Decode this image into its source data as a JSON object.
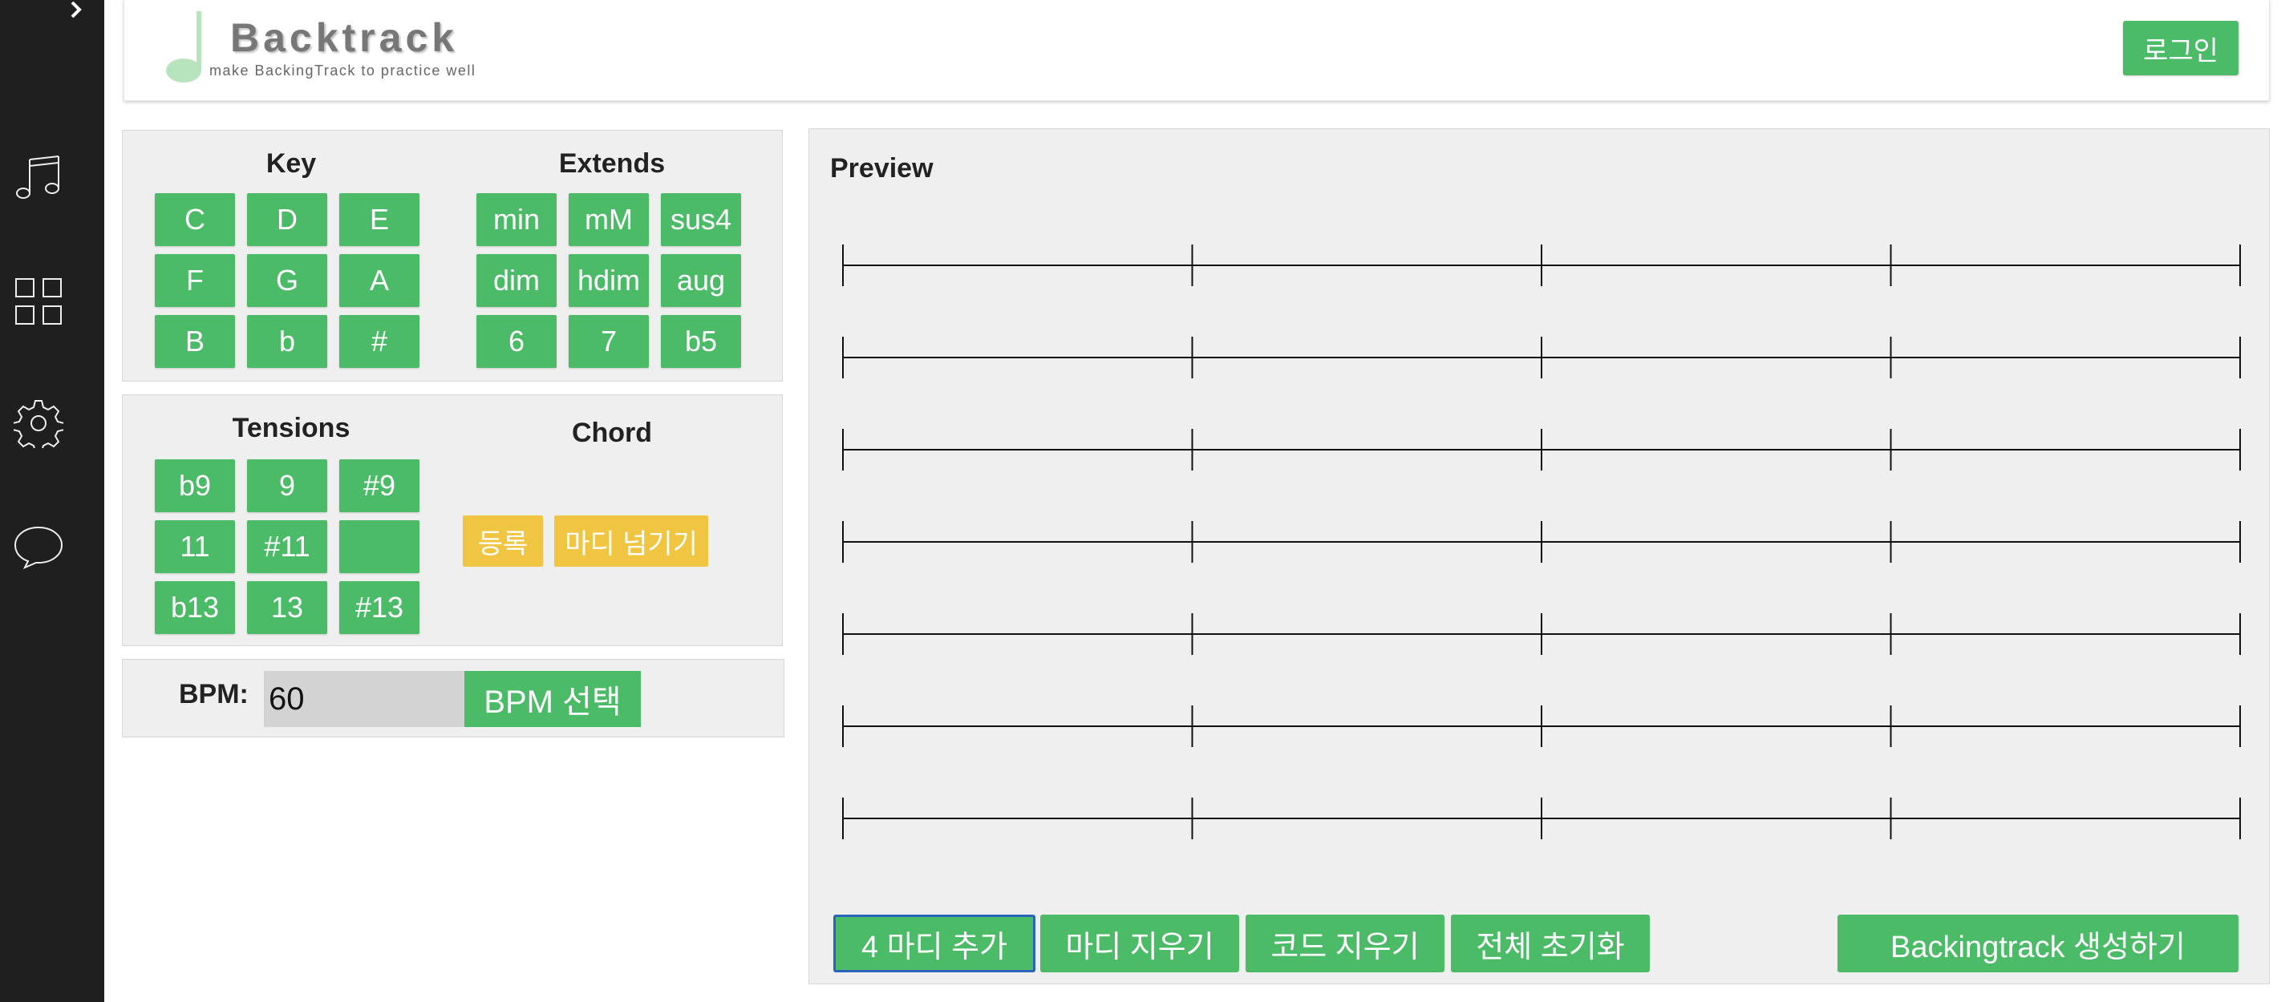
{
  "header": {
    "logo_title": "Backtrack",
    "logo_subtitle": "make BackingTrack to practice well",
    "login_label": "로그인"
  },
  "sidebar": {
    "icons": [
      "chevron-right-icon",
      "music-note-icon",
      "grid-icon",
      "gear-icon",
      "chat-bubble-icon"
    ]
  },
  "key": {
    "title": "Key",
    "buttons": [
      "C",
      "D",
      "E",
      "F",
      "G",
      "A",
      "B",
      "b",
      "#"
    ]
  },
  "extends": {
    "title": "Extends",
    "buttons": [
      "min",
      "mM",
      "sus4",
      "dim",
      "hdim",
      "aug",
      "6",
      "7",
      "b5"
    ]
  },
  "tensions": {
    "title": "Tensions",
    "buttons": [
      "b9",
      "9",
      "#9",
      "11",
      "#11",
      "",
      "b13",
      "13",
      "#13"
    ]
  },
  "chord": {
    "title": "Chord",
    "register_label": "등록",
    "next_bar_label": "마디 넘기기"
  },
  "bpm": {
    "label": "BPM:",
    "value": "60",
    "select_label": "BPM 선택"
  },
  "preview": {
    "title": "Preview",
    "rows": 7,
    "bars_per_row": 4
  },
  "actions": {
    "add_bars": "4 마디 추가",
    "delete_bar": "마디 지우기",
    "delete_chord": "코드 지우기",
    "reset_all": "전체 초기화",
    "generate": "Backingtrack 생성하기"
  },
  "colors": {
    "green": "#4cbb68",
    "yellow": "#f0c542",
    "sidebar": "#1f1f1f",
    "panel": "#efefef",
    "logo_note": "#b7e4bd"
  }
}
